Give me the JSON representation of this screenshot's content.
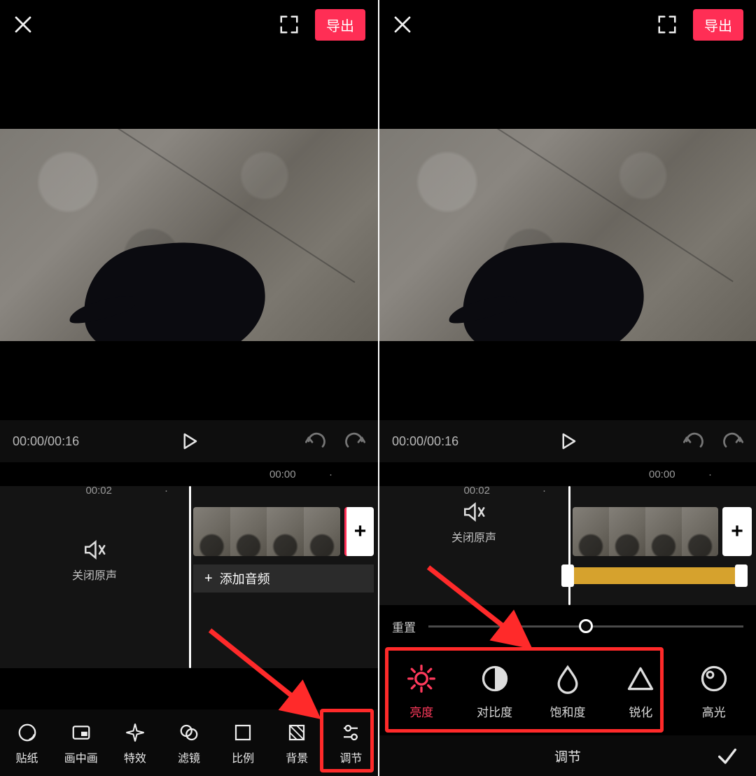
{
  "header": {
    "export_label": "导出"
  },
  "controls": {
    "time_display": "00:00/00:16"
  },
  "ruler": {
    "mark0": "00:00",
    "mark1": "·",
    "mark2": "00:02",
    "mark3": "·"
  },
  "mute": {
    "label": "关闭原声"
  },
  "add_audio": {
    "label": "添加音频",
    "plus": "+"
  },
  "add_clip": {
    "plus": "+"
  },
  "nav": [
    {
      "key": "sticker",
      "label": "贴纸"
    },
    {
      "key": "pip",
      "label": "画中画"
    },
    {
      "key": "effect",
      "label": "特效"
    },
    {
      "key": "filter",
      "label": "滤镜"
    },
    {
      "key": "ratio",
      "label": "比例"
    },
    {
      "key": "background",
      "label": "背景"
    },
    {
      "key": "adjust",
      "label": "调节"
    }
  ],
  "adjust": {
    "reset_label": "重置",
    "title": "调节",
    "items": [
      {
        "key": "brightness",
        "label": "亮度"
      },
      {
        "key": "contrast",
        "label": "对比度"
      },
      {
        "key": "saturation",
        "label": "饱和度"
      },
      {
        "key": "sharpen",
        "label": "锐化"
      },
      {
        "key": "highlight",
        "label": "高光"
      }
    ]
  },
  "colors": {
    "accent": "#ff2e55",
    "annotation": "#ff2a2a"
  }
}
